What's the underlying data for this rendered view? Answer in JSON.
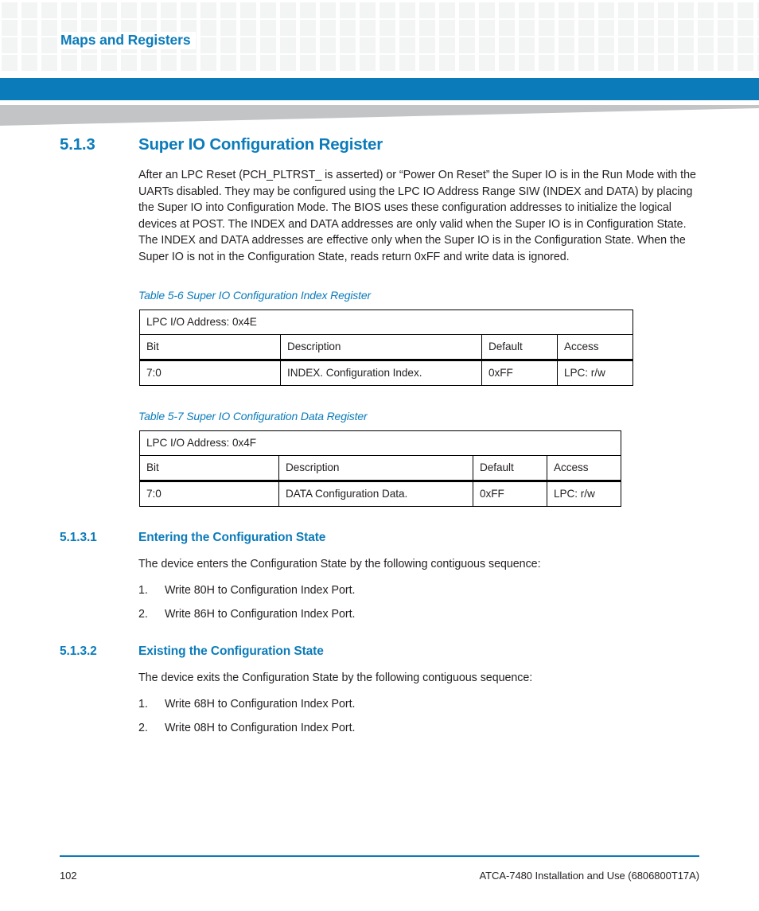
{
  "header": {
    "running_title": "Maps and Registers",
    "accent_color": "#0b7bba",
    "wedge_color": "#c2c4c6",
    "pattern_color": "#f3f4f4"
  },
  "section": {
    "number": "5.1.3",
    "title": "Super IO Configuration Register",
    "paragraph": "After an LPC Reset (PCH_PLTRST_ is asserted) or “Power On Reset” the Super IO is in the Run Mode with the UARTs disabled. They may be configured using the LPC IO Address Range SIW (INDEX and DATA) by placing the Super IO into Configuration Mode. The BIOS uses these configuration addresses to initialize the logical devices at POST. The INDEX and DATA addresses are only valid when the Super IO is in Configuration State. The INDEX and DATA addresses are effective only when the Super IO is in the Configuration State. When the Super IO is not in the Configuration State, reads return 0xFF and write data is ignored."
  },
  "tables": [
    {
      "caption": "Table 5-6 Super IO Configuration Index Register",
      "address_row": "LPC I/O Address: 0x4E",
      "columns": [
        "Bit",
        "Description",
        "Default",
        "Access"
      ],
      "rows": [
        [
          "7:0",
          "INDEX. Configuration Index.",
          "0xFF",
          "LPC: r/w"
        ]
      ]
    },
    {
      "caption": "Table 5-7 Super IO Configuration Data Register",
      "address_row": "LPC I/O Address: 0x4F",
      "columns": [
        "Bit",
        "Description",
        "Default",
        "Access"
      ],
      "rows": [
        [
          "7:0",
          "DATA Configuration Data.",
          "0xFF",
          "LPC: r/w"
        ]
      ]
    }
  ],
  "subsections": [
    {
      "number": "5.1.3.1",
      "title": "Entering the Configuration State",
      "intro": "The device enters the Configuration State by the following contiguous sequence:",
      "steps": [
        {
          "marker": "1.",
          "text": "Write 80H to Configuration Index Port."
        },
        {
          "marker": "2.",
          "text": "Write 86H to Configuration Index Port."
        }
      ]
    },
    {
      "number": "5.1.3.2",
      "title": "Existing the Configuration State",
      "intro": "The device exits the Configuration State by the following contiguous sequence:",
      "steps": [
        {
          "marker": "1.",
          "text": "Write 68H to Configuration Index Port."
        },
        {
          "marker": "2.",
          "text": "Write 08H to Configuration Index Port."
        }
      ]
    }
  ],
  "footer": {
    "page_number": "102",
    "document_title": "ATCA-7480 Installation and Use (6806800T17A)"
  }
}
